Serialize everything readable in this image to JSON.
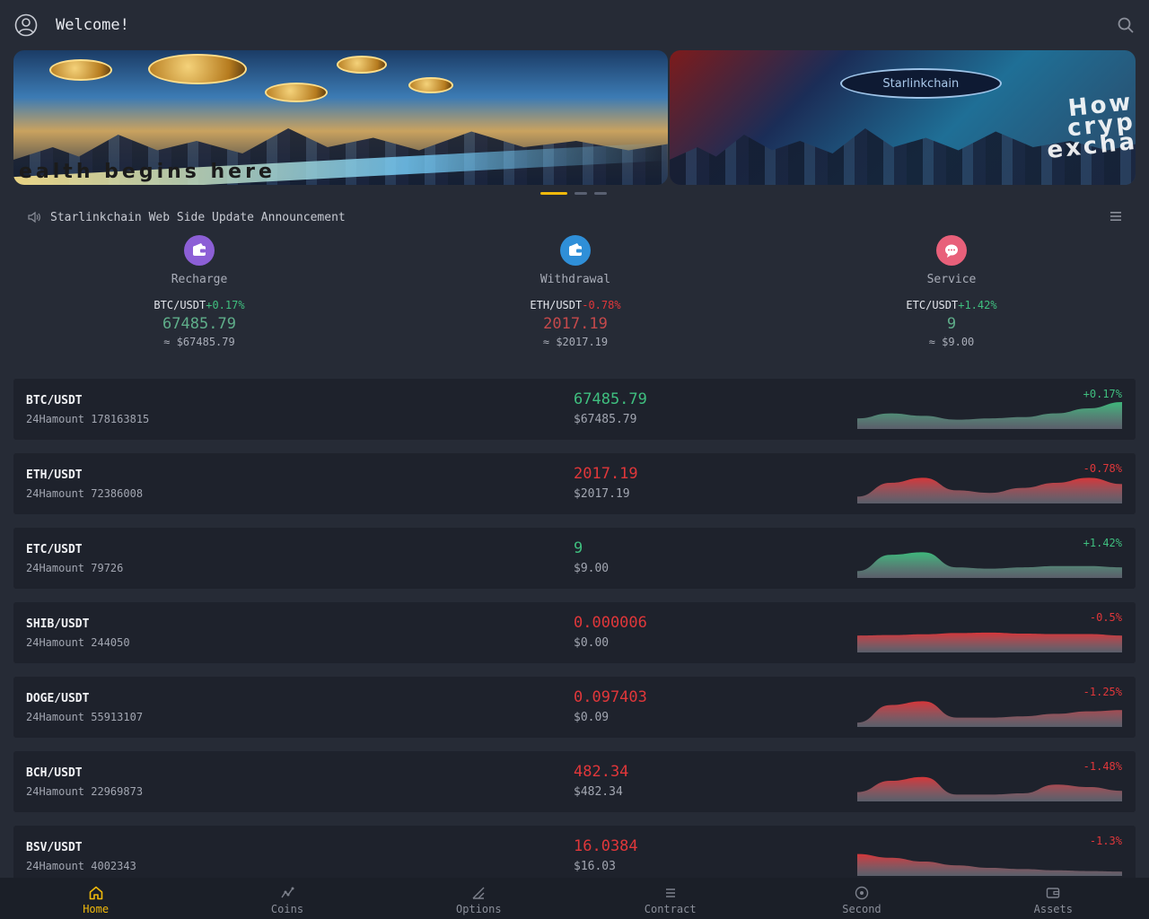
{
  "header": {
    "welcome": "Welcome!"
  },
  "banner": {
    "slide1_caption": "ealth begins here",
    "slide2_badge": "Starlinkchain",
    "slide2_overlay": [
      "How",
      "cryp",
      "excha"
    ]
  },
  "announcement": {
    "text": "Starlinkchain Web Side Update Announcement"
  },
  "quick": [
    {
      "label": "Recharge",
      "pair": "BTC/USDT",
      "change": "+0.17%",
      "price": "67485.79",
      "approx": "≈ $67485.79",
      "color": "#8c5fd6",
      "icon": "wallet-icon",
      "trend": "up"
    },
    {
      "label": "Withdrawal",
      "pair": "ETH/USDT",
      "change": "-0.78%",
      "price": "2017.19",
      "approx": "≈ $2017.19",
      "color": "#2f8fd8",
      "icon": "wallet-icon",
      "trend": "down"
    },
    {
      "label": "Service",
      "pair": "ETC/USDT",
      "change": "+1.42%",
      "price": "9",
      "approx": "≈ $9.00",
      "color": "#e8607a",
      "icon": "chat-icon",
      "trend": "up"
    }
  ],
  "market": [
    {
      "symbol": "BTC/USDT",
      "volume": "24Hamount 178163815",
      "price": "67485.79",
      "usd": "$67485.79",
      "pct": "+0.17%",
      "trend": "up",
      "spark": [
        0.35,
        0.55,
        0.45,
        0.3,
        0.35,
        0.4,
        0.55,
        0.75,
        1.0
      ]
    },
    {
      "symbol": "ETH/USDT",
      "volume": "24Hamount 72386008",
      "price": "2017.19",
      "usd": "$2017.19",
      "pct": "-0.78%",
      "trend": "down",
      "spark": [
        0.2,
        0.75,
        0.95,
        0.45,
        0.35,
        0.55,
        0.75,
        0.95,
        0.7
      ]
    },
    {
      "symbol": "ETC/USDT",
      "volume": "24Hamount 79726",
      "price": "9",
      "usd": "$9.00",
      "pct": "+1.42%",
      "trend": "up",
      "spark": [
        0.2,
        0.85,
        0.95,
        0.35,
        0.3,
        0.35,
        0.4,
        0.4,
        0.35
      ]
    },
    {
      "symbol": "SHIB/USDT",
      "volume": "24Hamount 244050",
      "price": "0.000006",
      "usd": "$0.00",
      "pct": "-0.5%",
      "trend": "down",
      "spark": [
        0.6,
        0.62,
        0.65,
        0.7,
        0.72,
        0.68,
        0.66,
        0.66,
        0.6
      ]
    },
    {
      "symbol": "DOGE/USDT",
      "volume": "24Hamount 55913107",
      "price": "0.097403",
      "usd": "$0.09",
      "pct": "-1.25%",
      "trend": "down",
      "spark": [
        0.1,
        0.8,
        0.95,
        0.3,
        0.3,
        0.35,
        0.45,
        0.55,
        0.6
      ]
    },
    {
      "symbol": "BCH/USDT",
      "volume": "24Hamount 22969873",
      "price": "482.34",
      "usd": "$482.34",
      "pct": "-1.48%",
      "trend": "down",
      "spark": [
        0.3,
        0.75,
        0.9,
        0.2,
        0.2,
        0.25,
        0.6,
        0.5,
        0.35
      ]
    },
    {
      "symbol": "BSV/USDT",
      "volume": "24Hamount 4002343",
      "price": "16.0384",
      "usd": "$16.03",
      "pct": "-1.3%",
      "trend": "down",
      "spark": [
        0.8,
        0.65,
        0.5,
        0.35,
        0.25,
        0.2,
        0.15,
        0.12,
        0.1
      ]
    }
  ],
  "nav": [
    {
      "label": "Home",
      "icon": "home-icon",
      "active": true
    },
    {
      "label": "Coins",
      "icon": "coins-icon",
      "active": false
    },
    {
      "label": "Options",
      "icon": "options-icon",
      "active": false
    },
    {
      "label": "Contract",
      "icon": "contract-icon",
      "active": false
    },
    {
      "label": "Second",
      "icon": "second-icon",
      "active": false
    },
    {
      "label": "Assets",
      "icon": "assets-icon",
      "active": false
    }
  ],
  "colors": {
    "up": "#3fbf7f",
    "down": "#e0373a",
    "accent": "#f0b90b"
  }
}
